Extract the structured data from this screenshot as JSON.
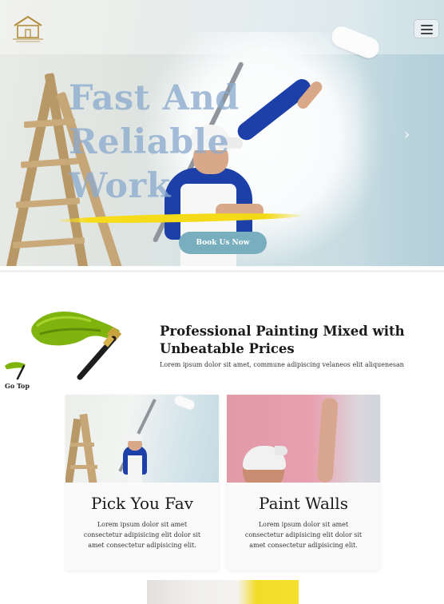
{
  "header": {
    "logo_icon": "house-logo-icon",
    "menu_icon": "hamburger-menu-icon"
  },
  "hero": {
    "title_line1": "Fast And",
    "title_line2": "Reliable",
    "title_line3": "Work",
    "cta_label": "Book Us Now",
    "next_icon": "chevron-right-icon",
    "next_glyph": "›",
    "accent_color": "#f6dc1a",
    "button_color": "#78aebd"
  },
  "intro": {
    "heading": "Professional Painting Mixed with Unbeatable Prices",
    "subtext": "Lorem ipsum dolor sit amet, commune adipiscing velaneos elit aliquenesan",
    "brush_icon": "paint-brush-icon"
  },
  "go_top": {
    "label": "Go Top",
    "icon": "paint-brush-icon"
  },
  "cards": [
    {
      "title": "Pick You Fav",
      "description": "Lorem ipsum dolor sit amet consectetur adipisicing elit dolor sit amet consectetur adipisicing elit."
    },
    {
      "title": "Paint Walls",
      "description": "Lorem ipsum dolor sit amet consectetur adipisicing elit dolor sit amet consectetur adipisicing elit."
    }
  ]
}
